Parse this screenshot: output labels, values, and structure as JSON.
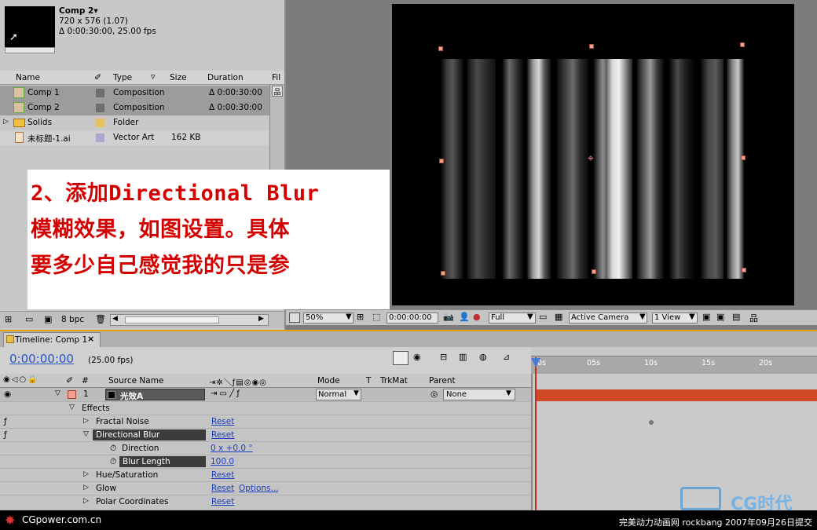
{
  "project": {
    "comp_name": "Comp 2▾",
    "comp_size": "720 x 576 (1.07)",
    "comp_duration": "Δ 0:00:30:00, 25.00 fps",
    "columns": [
      "Name",
      "Type",
      "Size",
      "Duration",
      "Fil"
    ],
    "items": [
      {
        "name": "Comp 1",
        "type": "Composition",
        "size": "",
        "duration": "Δ 0:00:30:00"
      },
      {
        "name": "Comp 2",
        "type": "Composition",
        "size": "",
        "duration": "Δ 0:00:30:00"
      },
      {
        "name": "Solids",
        "type": "Folder",
        "size": "",
        "duration": ""
      },
      {
        "name": "未标题-1.ai",
        "type": "Vector Art",
        "size": "162 KB",
        "duration": ""
      }
    ],
    "bpc": "8 bpc"
  },
  "annotation": {
    "line1": "2、添加Directional Blur",
    "line2": "模糊效果，如图设置。具体",
    "line3": "要多少自己感觉我的只是参"
  },
  "viewer": {
    "zoom": "50%",
    "timecode": "0:00:00:00",
    "resolution": "Full",
    "camera": "Active Camera",
    "view": "1 View"
  },
  "timeline": {
    "tab": "Timeline: Comp 1",
    "close": "×",
    "timecode": "0:00:00:00",
    "fps": "(25.00 fps)",
    "columns": {
      "num": "#",
      "source": "Source Name",
      "mode": "Mode",
      "t": "T",
      "trkmat": "TrkMat",
      "parent": "Parent"
    },
    "layer": {
      "num": "1",
      "name": "光效A",
      "mode": "Normal",
      "parent": "None"
    },
    "effects_label": "Effects",
    "effects": [
      {
        "name": "Fractal Noise",
        "reset": "Reset"
      },
      {
        "name": "Directional Blur",
        "reset": "Reset"
      },
      {
        "name": "Direction",
        "value": "0 x +0.0 °"
      },
      {
        "name": "Blur Length",
        "value": "100.0"
      },
      {
        "name": "Hue/Saturation",
        "reset": "Reset"
      },
      {
        "name": "Glow",
        "reset": "Reset",
        "options": "Options..."
      },
      {
        "name": "Polar Coordinates",
        "reset": "Reset"
      }
    ],
    "ruler": [
      "0s",
      "05s",
      "10s",
      "15s",
      "20s"
    ]
  },
  "footer": {
    "left": "CGpower.com.cn",
    "right": "完美动力动画网 rockbang 2007年09月26日提交",
    "logo": "CG时代"
  }
}
